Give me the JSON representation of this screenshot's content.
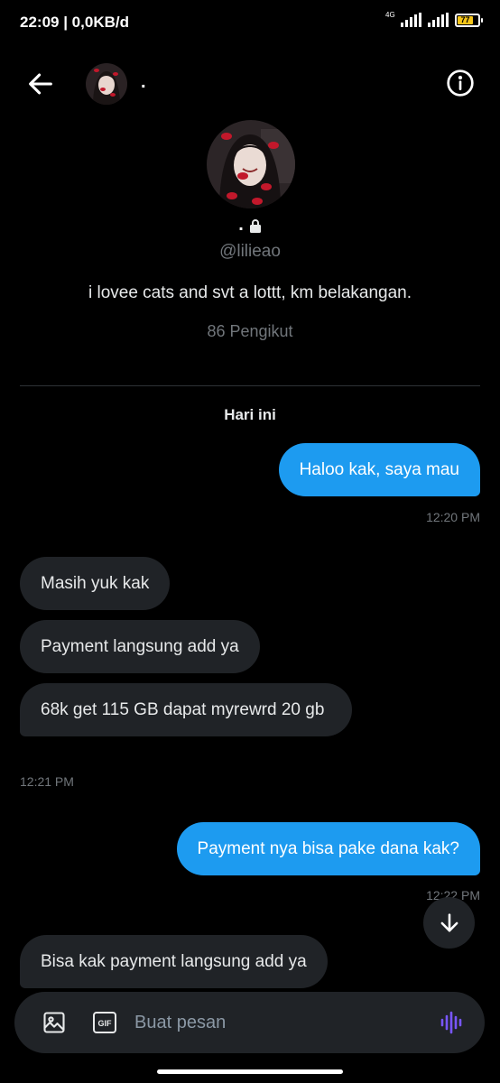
{
  "status_bar": {
    "time": "22:09 | 0,0KB/d",
    "network": "4G",
    "battery": "77"
  },
  "header": {
    "name": "."
  },
  "profile": {
    "name": ".",
    "handle": "@lilieao",
    "bio": "i lovee cats and svt a lottt, km belakangan.",
    "followers": "86 Pengikut"
  },
  "conversation": {
    "date_label": "Hari ini",
    "messages": [
      {
        "text": "Haloo kak, saya mau",
        "direction": "out"
      },
      {
        "text": "Masih yuk kak",
        "direction": "in"
      },
      {
        "text": "Payment langsung add ya",
        "direction": "in"
      },
      {
        "text": "68k get 115 GB dapat myrewrd 20 gb",
        "direction": "in"
      },
      {
        "text": "Payment nya bisa pake dana kak?",
        "direction": "out"
      },
      {
        "text": "Bisa kak payment langsung add ya",
        "direction": "in"
      }
    ],
    "timestamps": [
      "12:20 PM",
      "12:21 PM",
      "12:22 PM"
    ]
  },
  "composer": {
    "placeholder": "Buat pesan",
    "gif_label": "GIF"
  },
  "colors": {
    "background": "#000000",
    "accent": "#1d9bf0",
    "incoming_bubble": "#202327",
    "muted_text": "#71767b",
    "battery": "#f5c518",
    "voice_icon": "#7856ff"
  },
  "icons": [
    "arrow-left-icon",
    "info-icon",
    "lock-icon",
    "arrow-down-icon",
    "image-icon",
    "gif-icon",
    "voice-wave-icon"
  ]
}
